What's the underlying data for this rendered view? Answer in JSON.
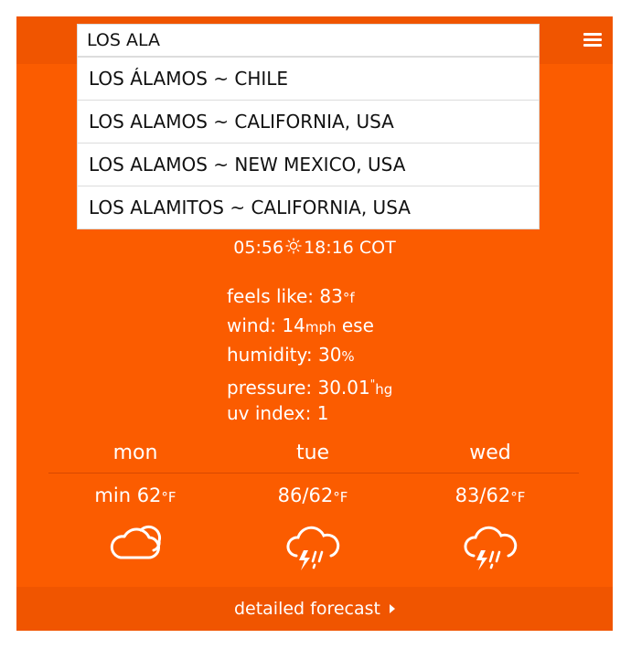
{
  "search": {
    "value": "LOS ALA"
  },
  "suggestions": [
    "LOS ÁLAMOS ~ CHILE",
    "LOS ALAMOS ~ CALIFORNIA, USA",
    "LOS ALAMOS ~ NEW MEXICO, USA",
    "LOS ALAMITOS ~ CALIFORNIA, USA"
  ],
  "sun": {
    "sunrise": "05:56",
    "sunset": "18:16",
    "tz": "COT",
    "icon": "sun-icon"
  },
  "details": {
    "feels_label": "feels like: ",
    "feels_value": "83",
    "feels_unit": "°f",
    "wind_label": "wind: ",
    "wind_value": "14",
    "wind_unit": "mph",
    "wind_dir": " ese",
    "humidity_label": "humidity: ",
    "humidity_value": "30",
    "humidity_unit": "%",
    "pressure_label": "pressure: ",
    "pressure_value": "30.01",
    "pressure_unit1": "\"",
    "pressure_unit2": "hg",
    "uv_label": "uv index: ",
    "uv_value": "1"
  },
  "forecast": [
    {
      "day": "mon",
      "temp": "min 62",
      "unit": "°F",
      "icon": "cloud-icon"
    },
    {
      "day": "tue",
      "temp": "86/62",
      "unit": "°F",
      "icon": "thunderstorm-icon"
    },
    {
      "day": "wed",
      "temp": "83/62",
      "unit": "°F",
      "icon": "thunderstorm-icon"
    }
  ],
  "footer": {
    "link": "detailed forecast"
  },
  "colors": {
    "accent": "#fb5c00",
    "bar": "#f05500",
    "text": "#ffffff"
  },
  "menu_icon": "hamburger-menu-icon"
}
